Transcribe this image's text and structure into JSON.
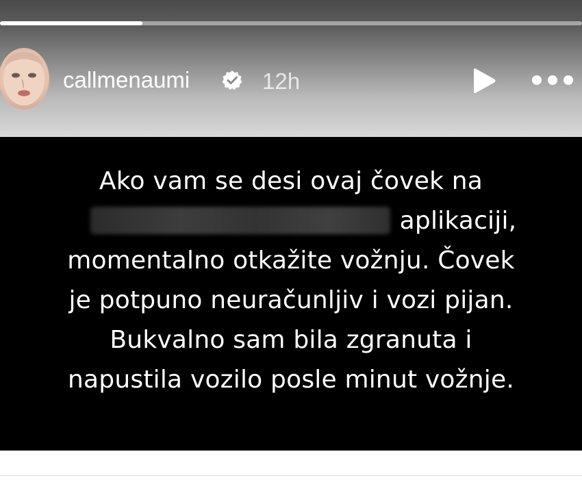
{
  "story": {
    "username": "callmenaumi",
    "verified": true,
    "time_ago": "12h",
    "progress": 0.245,
    "icons": {
      "verified": "verified-badge-icon",
      "play": "play-icon",
      "more": "more-options-icon"
    }
  },
  "message": {
    "line1": "Ako vam se desi ovaj čovek na",
    "line2_visible": "aplikaciji,",
    "line3": "momentalno otkažite vožnju. Čovek",
    "line4": "je potpuno neuračunljiv i vozi pijan.",
    "line5": "Bukvalno sam bila zgranuta i",
    "line6": "napustila vozilo posle minut vožnje."
  },
  "colors": {
    "message_background": "#000000",
    "message_text": "#ffffff"
  }
}
